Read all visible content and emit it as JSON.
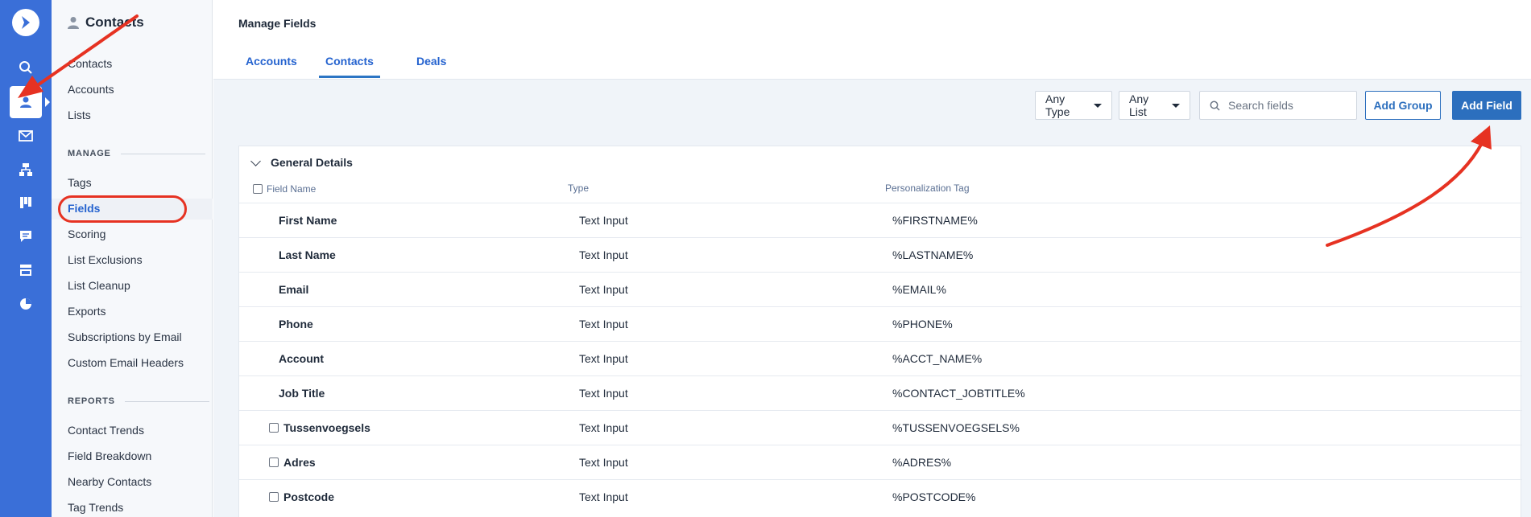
{
  "sidebar": {
    "title": "Contacts",
    "items_top": [
      "Contacts",
      "Accounts",
      "Lists"
    ],
    "manage_label": "MANAGE",
    "manage_items": [
      "Tags",
      "Fields",
      "Scoring",
      "List Exclusions",
      "List Cleanup",
      "Exports",
      "Subscriptions by Email",
      "Custom Email Headers"
    ],
    "reports_label": "REPORTS",
    "report_items": [
      "Contact Trends",
      "Field Breakdown",
      "Nearby Contacts",
      "Tag Trends"
    ]
  },
  "rail_icons": [
    "logo-icon",
    "search-icon",
    "contacts-icon",
    "email-icon",
    "automations-icon",
    "deals-icon",
    "conversations-icon",
    "website-icon",
    "reports-icon"
  ],
  "header": {
    "title": "Manage Fields",
    "tabs": [
      "Accounts",
      "Contacts",
      "Deals"
    ],
    "active_tab": "Contacts"
  },
  "toolbar": {
    "type_filter": "Any Type",
    "list_filter": "Any List",
    "search_placeholder": "Search fields",
    "add_group": "Add Group",
    "add_field": "Add Field"
  },
  "group": {
    "title": "General Details",
    "columns": [
      "Field Name",
      "Type",
      "Personalization Tag"
    ],
    "rows": [
      {
        "name": "First Name",
        "type": "Text Input",
        "tag": "%FIRSTNAME%",
        "checkbox": false
      },
      {
        "name": "Last Name",
        "type": "Text Input",
        "tag": "%LASTNAME%",
        "checkbox": false
      },
      {
        "name": "Email",
        "type": "Text Input",
        "tag": "%EMAIL%",
        "checkbox": false
      },
      {
        "name": "Phone",
        "type": "Text Input",
        "tag": "%PHONE%",
        "checkbox": false
      },
      {
        "name": "Account",
        "type": "Text Input",
        "tag": "%ACCT_NAME%",
        "checkbox": false
      },
      {
        "name": "Job Title",
        "type": "Text Input",
        "tag": "%CONTACT_JOBTITLE%",
        "checkbox": false
      },
      {
        "name": "Tussenvoegsels",
        "type": "Text Input",
        "tag": "%TUSSENVOEGSELS%",
        "checkbox": true
      },
      {
        "name": "Adres",
        "type": "Text Input",
        "tag": "%ADRES%",
        "checkbox": true
      },
      {
        "name": "Postcode",
        "type": "Text Input",
        "tag": "%POSTCODE%",
        "checkbox": true
      }
    ]
  },
  "colors": {
    "rail": "#3a6fd8",
    "accent": "#2c6fbe",
    "annotation": "#e63222"
  }
}
